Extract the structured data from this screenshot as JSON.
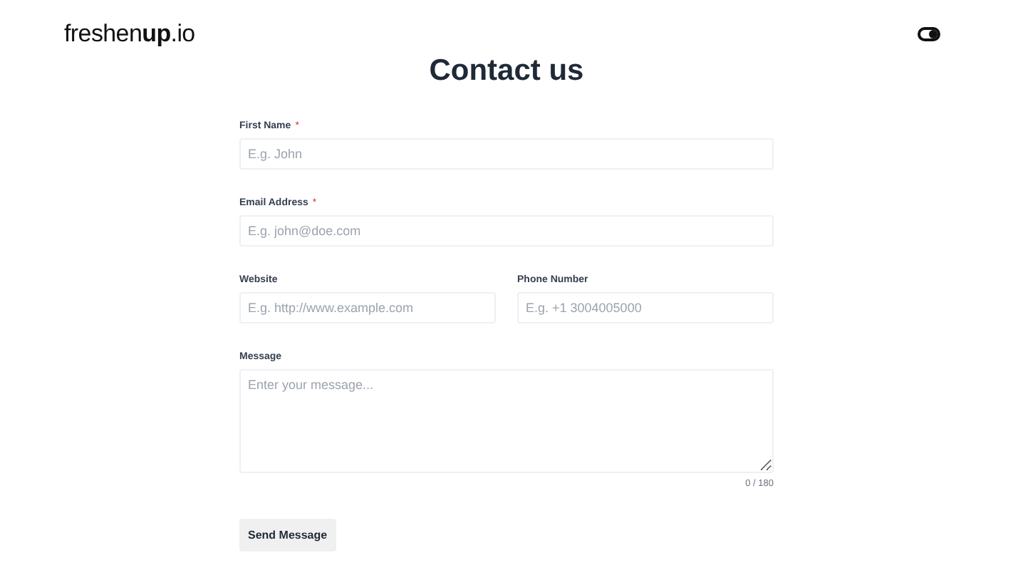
{
  "header": {
    "logo": "freshen**up**.io"
  },
  "title": "Contact us",
  "rows": [
    [
      {
        "kind": "input",
        "label": "First Name",
        "required_mark": "*",
        "placeholder": "E.g. John"
      }
    ],
    [
      {
        "kind": "input",
        "label": "Email Address",
        "required_mark": "*",
        "placeholder": "E.g. john@doe.com"
      }
    ],
    [
      {
        "kind": "input",
        "label": "Website",
        "placeholder": "E.g. http://www.example.com"
      },
      {
        "kind": "input",
        "label": "Phone Number",
        "placeholder": "E.g. +1 3004005000"
      }
    ],
    [
      {
        "kind": "textarea",
        "label": "Message",
        "placeholder": "Enter your message...",
        "counter": "0 / 180"
      }
    ]
  ],
  "submit": "Send Message"
}
